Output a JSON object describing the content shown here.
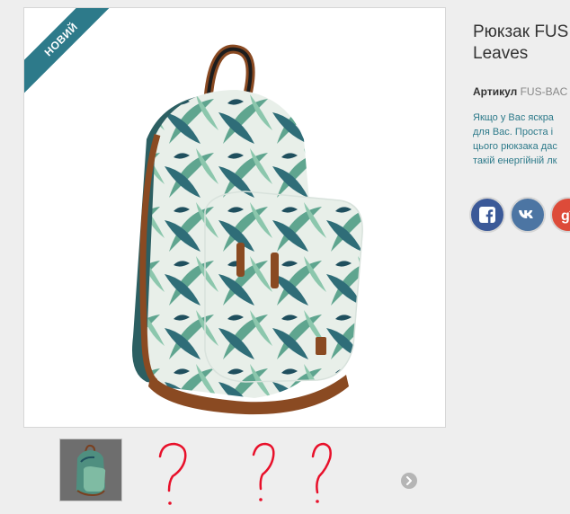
{
  "badge": {
    "label": "НОВИЙ"
  },
  "product": {
    "title_line1": "Рюкзак FUS",
    "title_line2": "Leaves",
    "sku_label": "Артикул",
    "sku_value": "FUS-BAC",
    "description_lines": [
      "Якщо у Вас яскра",
      "для Вас. Проста і",
      "цього рюкзака дас",
      "такій енергійній лк"
    ]
  },
  "social": {
    "items": [
      {
        "name": "facebook",
        "icon": "facebook-icon",
        "color": "#3b5998"
      },
      {
        "name": "vkontakte",
        "icon": "vk-icon",
        "color": "#4c75a3"
      },
      {
        "name": "google-plus",
        "icon": "google-plus-icon",
        "color": "#dd4b39"
      }
    ]
  },
  "gallery": {
    "thumbnails": [
      {
        "icon": "backpack-thumbnail"
      }
    ],
    "annotations": [
      {
        "text": "?"
      },
      {
        "text": "?"
      },
      {
        "text": "?"
      }
    ],
    "next_icon": "chevron-right-icon"
  },
  "colors": {
    "accent": "#2d7a8a",
    "annotation": "#e8102a"
  }
}
